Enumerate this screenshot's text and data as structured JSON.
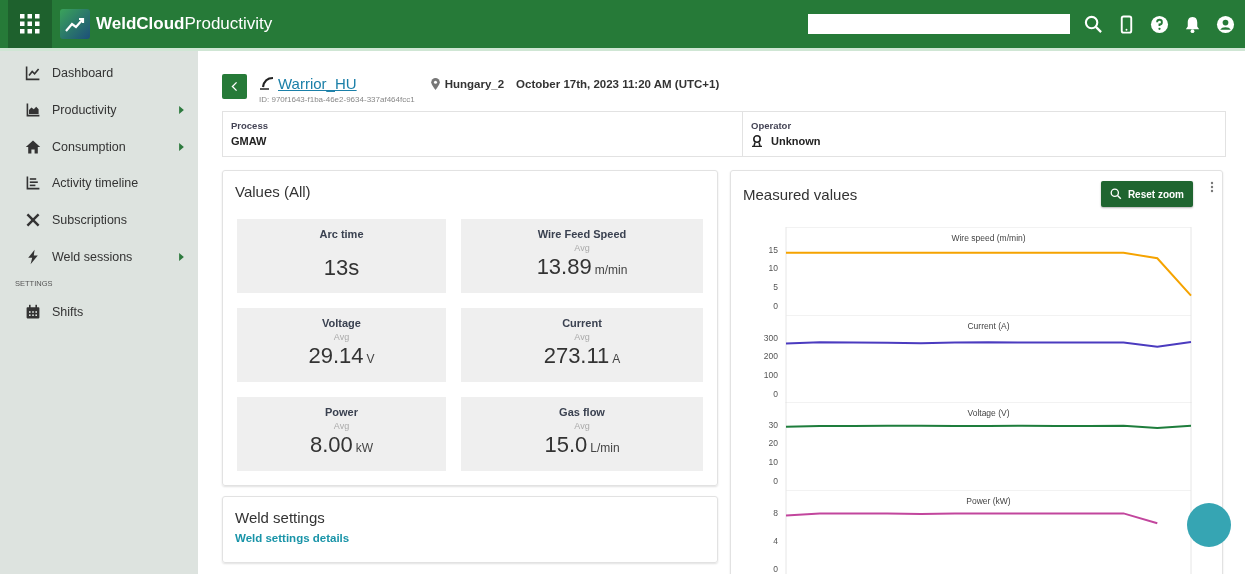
{
  "header": {
    "title": "**WeldCloud**Productivity"
  },
  "sidebar": {
    "items": [
      {
        "label": "Dashboard",
        "has_submenu": false
      },
      {
        "label": "Productivity",
        "has_submenu": true
      },
      {
        "label": "Consumption",
        "has_submenu": true
      },
      {
        "label": "Activity timeline",
        "has_submenu": false
      },
      {
        "label": "Subscriptions",
        "has_submenu": false
      },
      {
        "label": "Weld sessions",
        "has_submenu": true
      }
    ],
    "section_label": "SETTINGS",
    "section_items": [
      {
        "label": "Shifts",
        "has_submenu": false
      }
    ]
  },
  "session": {
    "machine": "Warrior_HU",
    "id": "ID: 970f1643-f1ba-46e2-9634-337af464fcc1",
    "location": "Hungary_2",
    "datetime": "October 17th, 2023 11:20 AM (UTC+1)"
  },
  "info": [
    {
      "label": "Process",
      "value": "GMAW"
    },
    {
      "label": "Operator",
      "value": "Unknown"
    }
  ],
  "values_card": {
    "title": "Values (All)",
    "tiles": [
      {
        "label": "Arc time",
        "value": "13s"
      },
      {
        "label": "Wire Feed Speed",
        "sublabel": "Avg",
        "value": "13.89",
        "unit": "m/min"
      },
      {
        "label": "Voltage",
        "sublabel": "Avg",
        "value": "29.14",
        "unit": "V"
      },
      {
        "label": "Current",
        "sublabel": "Avg",
        "value": "273.11",
        "unit": "A"
      },
      {
        "label": "Power",
        "sublabel": "Avg",
        "value": "8.00",
        "unit": "kW"
      },
      {
        "label": "Gas flow",
        "sublabel": "Avg",
        "value": "15.0",
        "unit": "L/min"
      }
    ]
  },
  "weld_settings": {
    "title": "Weld settings",
    "link": "Weld settings details"
  },
  "measured": {
    "title": "Measured values",
    "reset_button": "Reset zoom",
    "charts": [
      {
        "chart_data": {
          "type": "line",
          "title": "Wire speed (m/min)",
          "ylim": [
            0,
            15
          ],
          "yticks": [
            0,
            5,
            10,
            15
          ],
          "series": [
            {
              "color": "#f5a300",
              "values": [
                14,
                14,
                14,
                14,
                14,
                14,
                14,
                14,
                14,
                14,
                14,
                12.5,
                2.5
              ]
            }
          ]
        }
      },
      {
        "chart_data": {
          "type": "line",
          "title": "Current (A)",
          "ylim": [
            0,
            300
          ],
          "yticks": [
            0,
            100,
            200,
            300
          ],
          "series": [
            {
              "color": "#4b3bbf",
              "values": [
                265,
                272,
                270,
                269,
                267,
                270,
                272,
                270,
                270,
                271,
                270,
                248,
                273
              ]
            }
          ]
        }
      },
      {
        "chart_data": {
          "type": "line",
          "title": "Voltage (V)",
          "ylim": [
            0,
            30
          ],
          "yticks": [
            0,
            10,
            20,
            30
          ],
          "series": [
            {
              "color": "#1e7d3c",
              "values": [
                28.5,
                29,
                29,
                29.1,
                29.1,
                29,
                29,
                29.1,
                29,
                29,
                29.1,
                27.8,
                29.1
              ]
            }
          ]
        }
      },
      {
        "chart_data": {
          "type": "line",
          "title": "Power (kW)",
          "ylim": [
            0,
            8
          ],
          "yticks": [
            0,
            4,
            8
          ],
          "series": [
            {
              "color": "#c2469d",
              "values": [
                7.5,
                7.8,
                7.8,
                7.8,
                7.7,
                7.8,
                7.8,
                7.8,
                7.8,
                7.8,
                7.8,
                6.4,
                null
              ]
            }
          ]
        }
      }
    ]
  }
}
